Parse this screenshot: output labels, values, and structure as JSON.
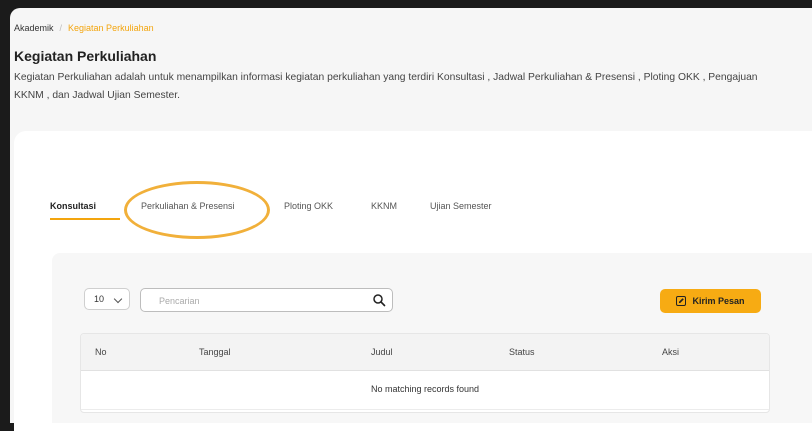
{
  "breadcrumb": {
    "home": "Akademik",
    "separator": "/",
    "current": "Kegiatan Perkuliahan"
  },
  "page": {
    "title": "Kegiatan Perkuliahan",
    "description": "Kegiatan Perkuliahan adalah untuk menampilkan informasi kegiatan perkuliahan yang terdiri Konsultasi , Jadwal Perkuliahan & Presensi , Ploting OKK , Pengajuan KKNM , dan Jadwal Ujian Semester."
  },
  "tabs": [
    {
      "label": "Konsultasi",
      "active": true
    },
    {
      "label": "Perkuliahan & Presensi",
      "active": false
    },
    {
      "label": "Ploting OKK",
      "active": false
    },
    {
      "label": "KKNM",
      "active": false
    },
    {
      "label": "Ujian Semester",
      "active": false
    }
  ],
  "toolbar": {
    "page_size": "10",
    "search_placeholder": "Pencarian",
    "send_label": "Kirim Pesan",
    "send_icon": "edit-icon",
    "search_icon": "search-icon"
  },
  "table": {
    "columns": [
      "No",
      "Tanggal",
      "Judul",
      "Status",
      "Aksi"
    ],
    "empty_message": "No matching records found"
  },
  "colors": {
    "accent": "#f7ab13",
    "annotation": "#f1b03a"
  }
}
